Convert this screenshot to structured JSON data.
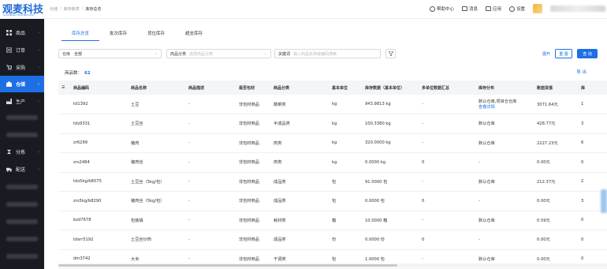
{
  "logo": {
    "text": "观麦科技",
    "sub": "GUANMAITECHNOLOGY"
  },
  "breadcrumb": [
    "仓储",
    "库存账表",
    "库存总览"
  ],
  "header": {
    "help": "帮助中心",
    "messages": "消息",
    "apps": "应用",
    "settings": "设置"
  },
  "sidebar": {
    "items": [
      {
        "label": "商品",
        "icon": "grid-icon"
      },
      {
        "label": "订单",
        "icon": "order-icon"
      },
      {
        "label": "采购",
        "icon": "cart-icon"
      },
      {
        "label": "仓储",
        "icon": "warehouse-icon",
        "active": true
      },
      {
        "label": "生产",
        "icon": "factory-icon"
      },
      {
        "label": "分拣",
        "icon": "sort-icon"
      },
      {
        "label": "配送",
        "icon": "truck-icon"
      }
    ]
  },
  "tabs": [
    "库存总览",
    "批次库存",
    "货位库存",
    "超支库存"
  ],
  "filters": {
    "warehouse_label": "仓库",
    "warehouse_value": "全部",
    "category_label": "商品分类",
    "category_placeholder": "选择商品分类",
    "keyword_label": "关键词",
    "keyword_placeholder": "输入商品名称或编码搜索"
  },
  "controls": {
    "expand": "展开",
    "reset": "重 置",
    "query": "查 询",
    "export": "导 出"
  },
  "count": {
    "label": "商品数：",
    "value": "62"
  },
  "table": {
    "headers": [
      "",
      "商品编码",
      "商品名称",
      "商品描述",
      "是否包材",
      "商品分类",
      "基本单位",
      "库存数据（基本单位）",
      "多单位数据汇总",
      "库存分布",
      "账面货值",
      "库"
    ],
    "rows": [
      [
        "td1392",
        "土豆",
        "-",
        "非包材商品",
        "蔬菜类",
        "kg",
        "943.9813 kg",
        "-",
        "默认仓库,项目仓仓库",
        "查看详情",
        "3071.64元",
        "1"
      ],
      [
        "tds9331",
        "土豆丝",
        "-",
        "非包材商品",
        "半成品类",
        "kg",
        "100.3380 kg",
        "-",
        "默认仓库",
        "",
        "428.77元",
        "3"
      ],
      [
        "zr6299",
        "猪肉",
        "-",
        "非包材商品",
        "肉类",
        "kg",
        "320.0000 kg",
        "-",
        "默认仓库",
        "",
        "2227.23元",
        "6"
      ],
      [
        "zrs2484",
        "猪肉丝",
        "-",
        "非包材商品",
        "肉类",
        "kg",
        "0.0000 kg",
        "0",
        "-",
        "",
        "0.00元",
        "0"
      ],
      [
        "tds5kg/b8075",
        "土豆丝（5kg/包）",
        "-",
        "非包材商品",
        "成品类",
        "包",
        "91.0000 包",
        "-",
        "默认仓库",
        "",
        "212.37元",
        "2"
      ],
      [
        "zrs5kg/b8290",
        "猪肉丝（5kg/包）",
        "-",
        "非包材商品",
        "成品类",
        "包",
        "0.0000 包",
        "0",
        "-",
        "",
        "0.00元",
        "3"
      ],
      [
        "bzd7678",
        "包装袋",
        "-",
        "非包材商品",
        "耗材类",
        "箱",
        "10.0000 箱",
        "-",
        "默认仓库",
        "",
        "0.59元",
        "0"
      ],
      [
        "tdsrr5192",
        "土豆丝炒肉",
        "-",
        "非包材商品",
        "成品类",
        "份",
        "0.0000 份",
        "0",
        "-",
        "",
        "0.00元",
        "0"
      ],
      [
        "dm3742",
        "大米",
        "-",
        "非包材商品",
        "干调类",
        "包",
        "1.0000 包",
        "-",
        "默认仓库",
        "",
        "0.00元",
        "0"
      ]
    ]
  }
}
